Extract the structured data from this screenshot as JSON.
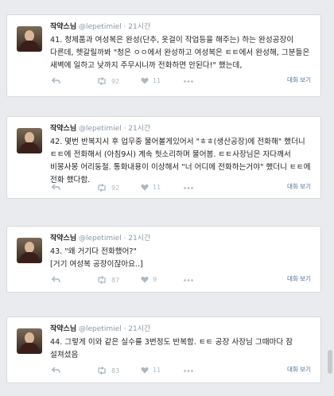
{
  "tweets": [
    {
      "name": "작약스님",
      "handle": "@lepetimiel",
      "dot": "·",
      "time": "21시간",
      "text": "41. 청제품과 여성복은 완성(단추, 옷걸이 작업등을 해주는) 하는 완성공장이 다른데, 헷갈릴까봐 \"청은 ㅇㅇ에서 완성하고 여성복은 ㅌㅌ에서 완성해, 그분들은 새벽에 일하고 낮까지 주무시니까 전화하면 안된다!\" 했는데,",
      "reply_icon": "reply-icon",
      "retweet_icon": "retweet-icon",
      "retweet_count": "92",
      "like_icon": "like-icon",
      "like_count": "11",
      "more_icon": "more-icon",
      "conversation_label": "대화 보기"
    },
    {
      "name": "작약스님",
      "handle": "@lepetimiel",
      "dot": "·",
      "time": "21시간",
      "text": "42. 몇번 반복지시 후 업무중 물어볼게있어서 \"ㅎㅎ(생산공장)에 전화해\" 했더니 ㅌㅌ에 전화해서 (아침9시) 계속 헛소리하며 물어봄. ㅌㅌ사장님은 자다깨서 비몽사몽 어리둥절. 통화내용이 이상해서 \"너 어디에 전화하는거야\" 했더니 ㅌㅌ에 전화 했다함.",
      "reply_icon": "reply-icon",
      "retweet_icon": "retweet-icon",
      "retweet_count": "92",
      "like_icon": "like-icon",
      "like_count": "11",
      "more_icon": "more-icon",
      "conversation_label": "대화 보기"
    },
    {
      "name": "작약스님",
      "handle": "@lepetimiel",
      "dot": "·",
      "time": "21시간",
      "text": "43. \"왜 거기다 전화했어?\"\n[거기 여성복 공장이잖아요..]",
      "reply_icon": "reply-icon",
      "retweet_icon": "retweet-icon",
      "retweet_count": "87",
      "like_icon": "like-icon",
      "like_count": "9",
      "more_icon": "more-icon",
      "conversation_label": "대화 보기"
    },
    {
      "name": "작약스님",
      "handle": "@lepetimiel",
      "dot": "·",
      "time": "21시간",
      "text": "44. 그렇게 이와 같은 실수를 3번정도 반복함. ㅌㅌ 공장 사장님 그때마다 잠 설쳐셨음",
      "reply_icon": "reply-icon",
      "retweet_icon": "retweet-icon",
      "retweet_count": "83",
      "like_icon": "like-icon",
      "like_count": "11",
      "more_icon": "more-icon",
      "conversation_label": "대화 보기"
    }
  ]
}
